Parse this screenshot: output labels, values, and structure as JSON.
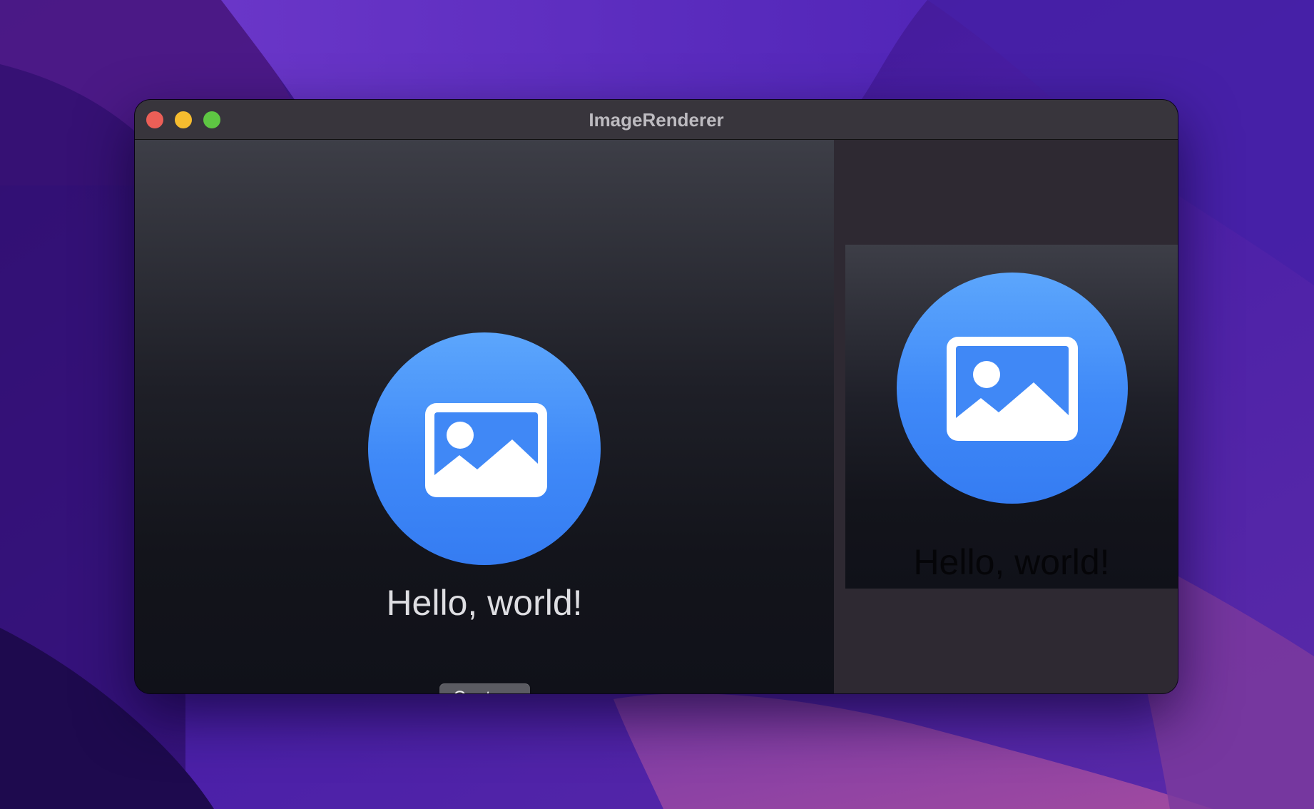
{
  "window": {
    "title": "ImageRenderer",
    "traffic_lights": {
      "close_color": "#ec5f57",
      "minimize_color": "#f6bc2f",
      "zoom_color": "#5ec643"
    }
  },
  "content": {
    "icon": "photo-icon",
    "accent_color": "#3f89f8",
    "greeting": "Hello, world!",
    "capture_label": "Capture"
  },
  "preview": {
    "icon": "photo-icon",
    "greeting": "Hello, world!"
  }
}
